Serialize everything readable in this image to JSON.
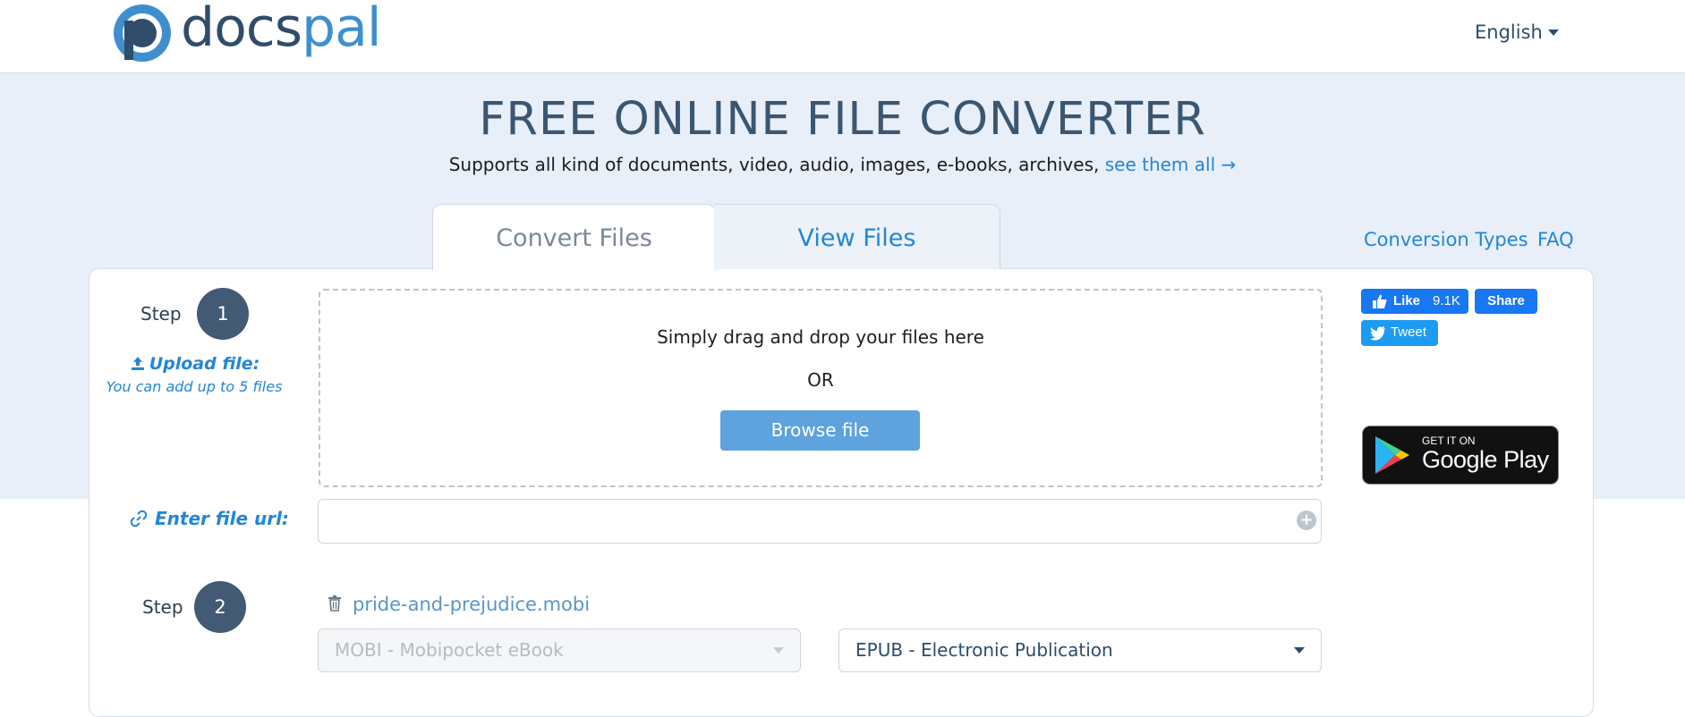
{
  "brand": {
    "name_part1": "docs",
    "name_part2": "pal",
    "colors": {
      "dark": "#2f4d6b",
      "accent": "#3f8fcf"
    }
  },
  "header": {
    "language": "English"
  },
  "hero": {
    "title": "FREE ONLINE FILE CONVERTER",
    "subtitle": "Supports all kind of documents, video, audio, images, e-books, archives,",
    "subtitle_link": "see them all →"
  },
  "tabs": [
    {
      "label": "Convert Files",
      "active": true
    },
    {
      "label": "View Files",
      "active": false
    }
  ],
  "top_links": {
    "conversion_types": "Conversion Types",
    "faq": "FAQ"
  },
  "step1": {
    "label": "Step",
    "number": "1",
    "upload_title": "Upload file:",
    "upload_hint": "You can add up to 5 files",
    "drop_text": "Simply drag and drop your files here",
    "or_text": "OR",
    "browse_label": "Browse file",
    "url_label": "Enter file url:",
    "url_value": ""
  },
  "step2": {
    "label": "Step",
    "number": "2",
    "file_name": "pride-and-prejudice.mobi",
    "from_format": "MOBI - Mobipocket eBook",
    "to_format": "EPUB - Electronic Publication"
  },
  "social": {
    "fb_like": "Like",
    "fb_count": "9.1K",
    "fb_share": "Share",
    "tweet": "Tweet",
    "gplay_small": "GET IT ON",
    "gplay_big": "Google Play"
  }
}
